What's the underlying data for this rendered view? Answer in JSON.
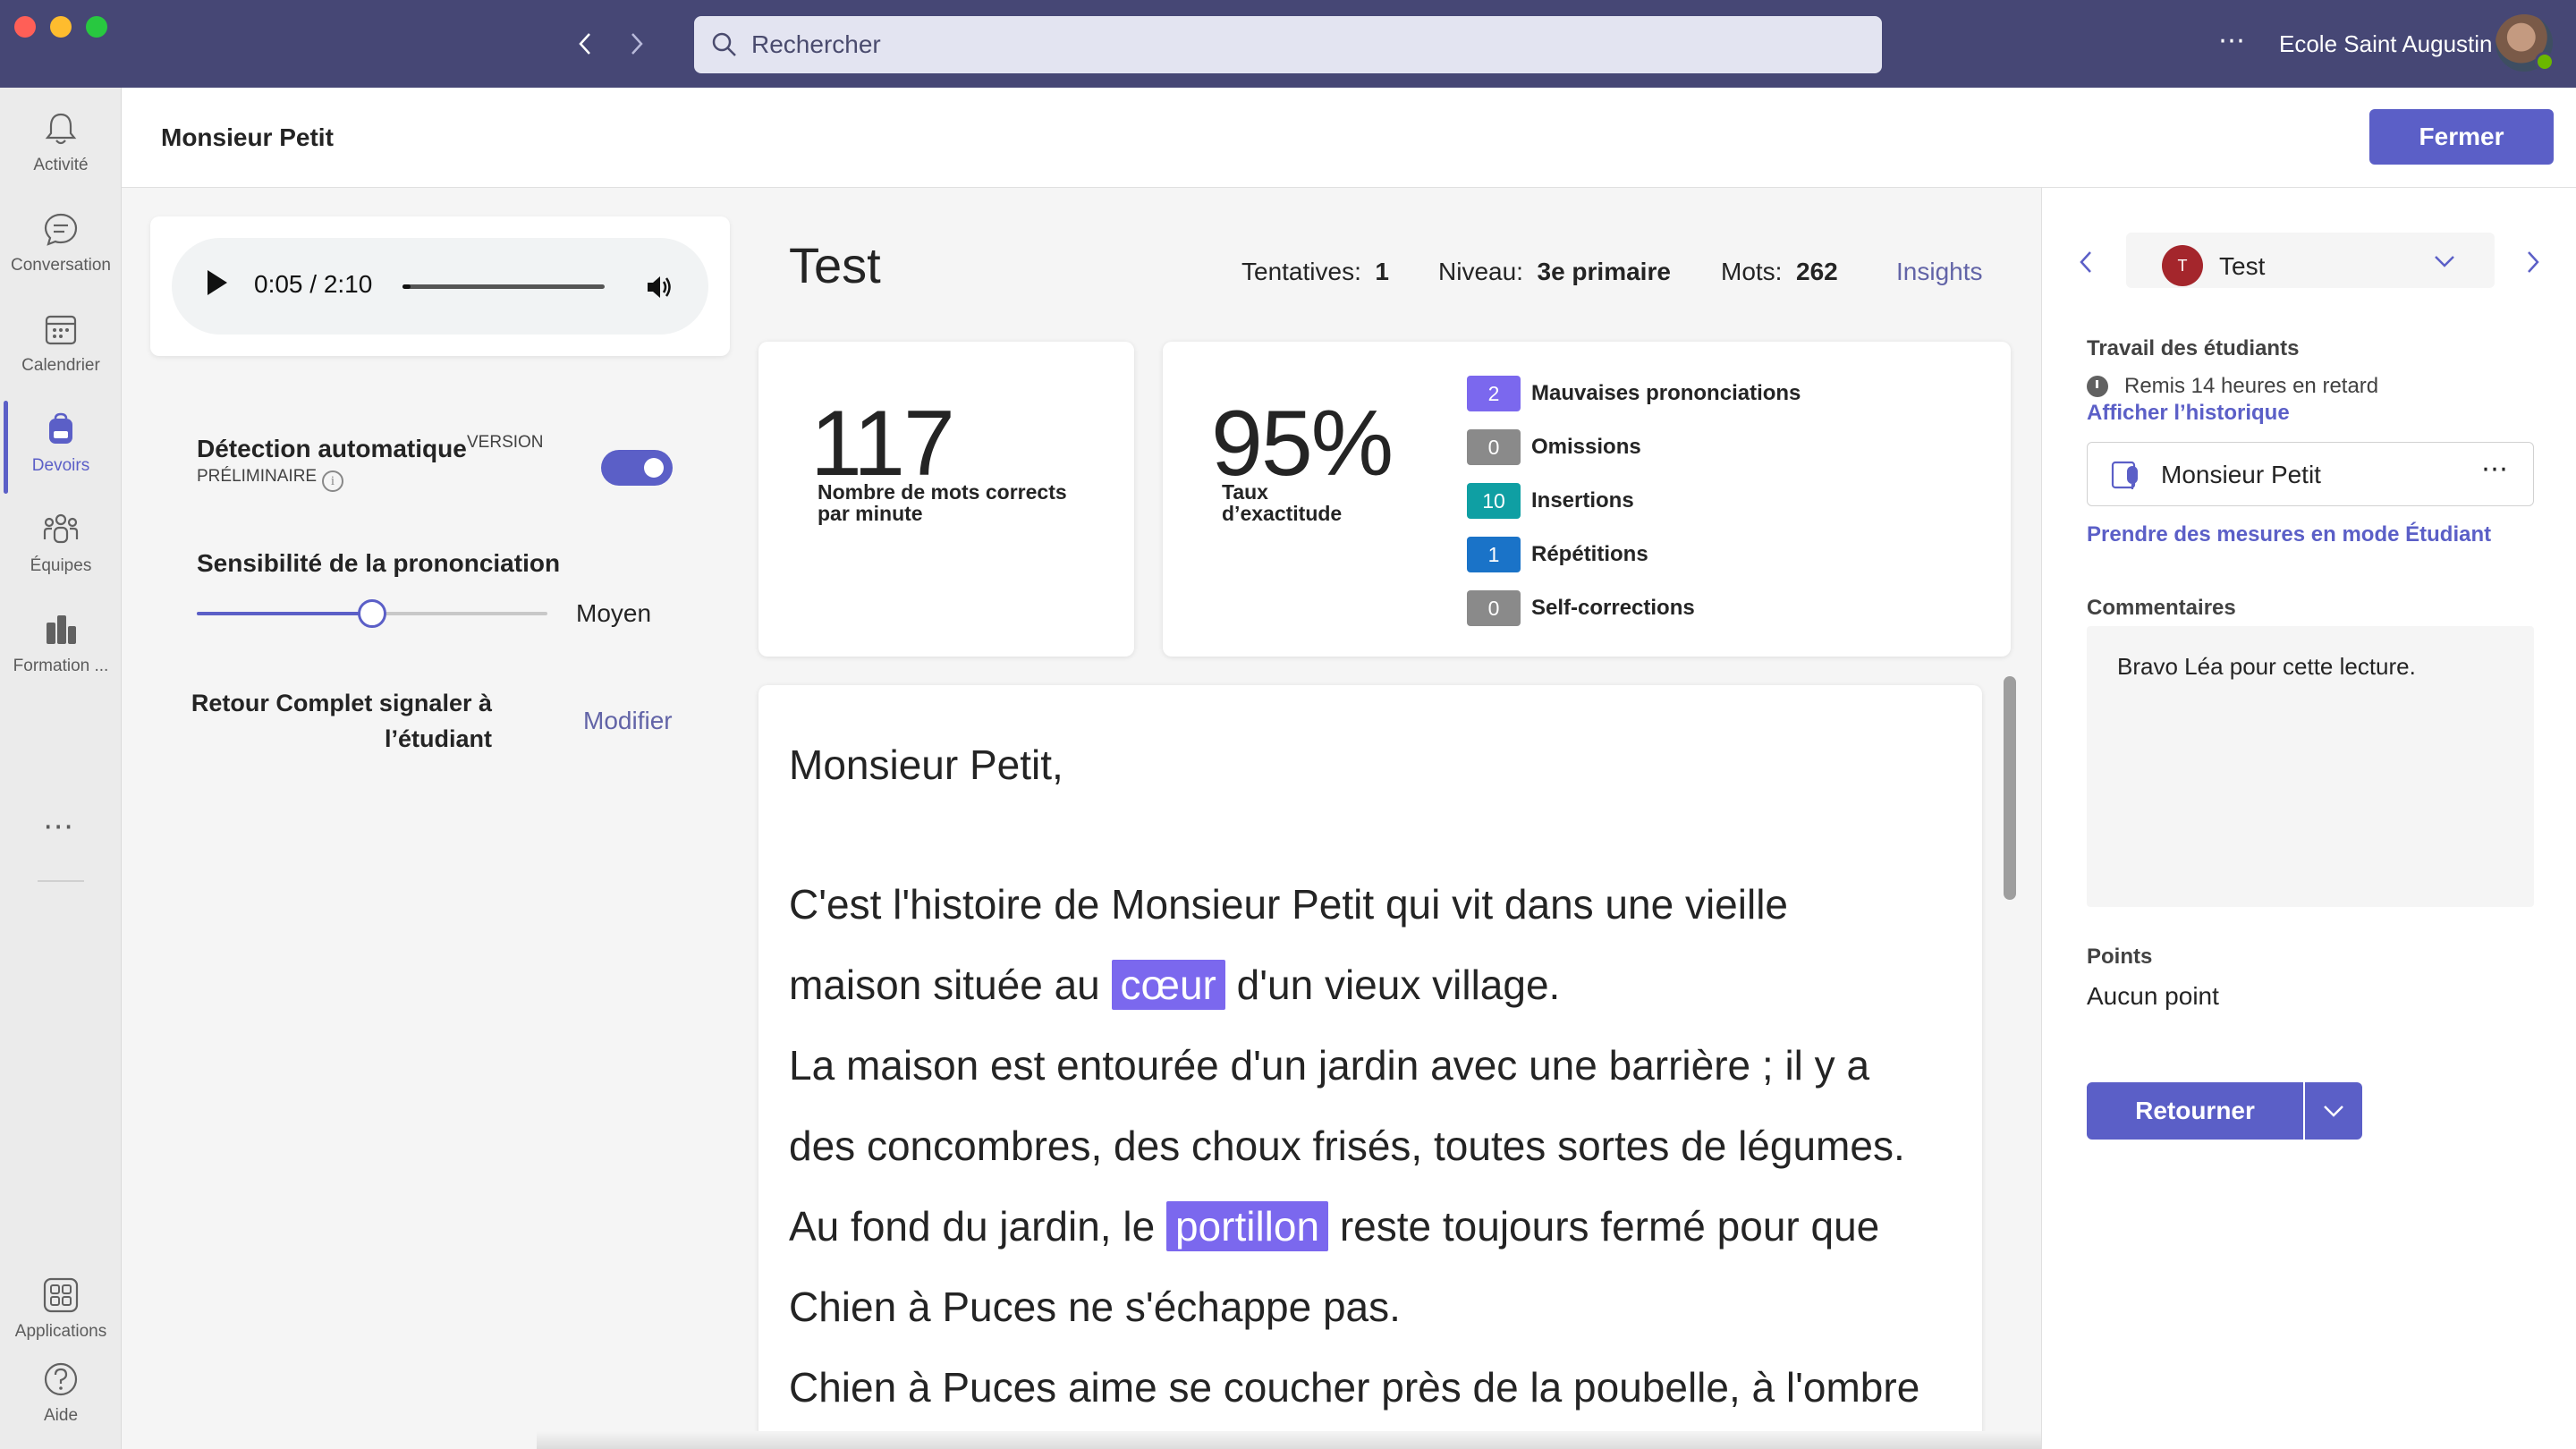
{
  "titlebar": {
    "search_placeholder": "Rechercher",
    "more": "⋯",
    "org_name": "Ecole Saint Augustin"
  },
  "rail": {
    "items": [
      {
        "label": "Activité",
        "icon": "bell-icon"
      },
      {
        "label": "Conversation",
        "icon": "chat-icon"
      },
      {
        "label": "Calendrier",
        "icon": "calendar-icon"
      },
      {
        "label": "Devoirs",
        "icon": "backpack-icon",
        "active": true
      },
      {
        "label": "Équipes",
        "icon": "teams-icon"
      },
      {
        "label": "Formation ...",
        "icon": "books-icon"
      },
      {
        "label": "Applications",
        "icon": "apps-icon"
      },
      {
        "label": "Aide",
        "icon": "help-icon"
      }
    ],
    "more": "⋯"
  },
  "header": {
    "title": "Monsieur Petit",
    "close_label": "Fermer"
  },
  "audio": {
    "time": "0:05 / 2:10",
    "progress": 0.04
  },
  "settings": {
    "detect_label": "Détection automatique",
    "preview_tag_1": "VERSION",
    "preview_tag_2": "PRÉLIMINAIRE",
    "toggle_on": true,
    "sensitivity_label": "Sensibilité de la prononciation",
    "sensitivity_value": "Moyen",
    "sensitivity_level": 0.5,
    "retour_label_1": "Retour Complet signaler à",
    "retour_label_2": "l’étudiant",
    "modify_label": "Modifier"
  },
  "results": {
    "title": "Test",
    "attempts_label": "Tentatives:",
    "attempts_value": "1",
    "level_label": "Niveau:",
    "level_value": "3e primaire",
    "words_label": "Mots:",
    "words_value": "262",
    "insights_label": "Insights",
    "wcpm_value": "117",
    "wcpm_caption_1": "Nombre de mots corrects",
    "wcpm_caption_2": "par minute",
    "accuracy_value": "95%",
    "accuracy_caption_1": "Taux",
    "accuracy_caption_2": "d’exactitude",
    "errors": [
      {
        "count": "2",
        "label": "Mauvaises prononciations",
        "color": "#7b68ee"
      },
      {
        "count": "0",
        "label": "Omissions",
        "color": "#8a8a8a"
      },
      {
        "count": "10",
        "label": "Insertions",
        "color": "#0f9fa3"
      },
      {
        "count": "1",
        "label": "Répétitions",
        "color": "#1a73c8"
      },
      {
        "count": "0",
        "label": "Self-corrections",
        "color": "#8a8a8a"
      }
    ]
  },
  "passage": {
    "greeting": "Monsieur Petit,",
    "l1a": "C'est l'histoire de Monsieur Petit qui vit dans une vieille",
    "l2a": "maison située au ",
    "l2hl": "cœur",
    "l2b": " d'un vieux village.",
    "l3": "La maison est entourée d'un jardin avec une barrière ; il y a",
    "l4": "des concombres, des choux frisés, toutes sortes de légumes.",
    "l5a": "Au fond du jardin, le ",
    "l5hl": "portillon",
    "l5b": " reste toujours fermé pour que",
    "l6": "Chien à Puces ne s'échappe pas.",
    "l7": "Chien à Puces aime se coucher près de la poubelle, à l'ombre"
  },
  "right_panel": {
    "student_initial": "T",
    "student_name": "Test",
    "work_label": "Travail des étudiants",
    "late_text": "Remis 14 heures en retard",
    "history_link": "Afficher l’historique",
    "file_name": "Monsieur Petit",
    "file_more": "⋯",
    "student_mode_link": "Prendre des mesures en mode Étudiant",
    "comments_label": "Commentaires",
    "comment_text": "Bravo Léa pour cette lecture.",
    "points_label": "Points",
    "points_value": "Aucun point",
    "return_label": "Retourner"
  }
}
